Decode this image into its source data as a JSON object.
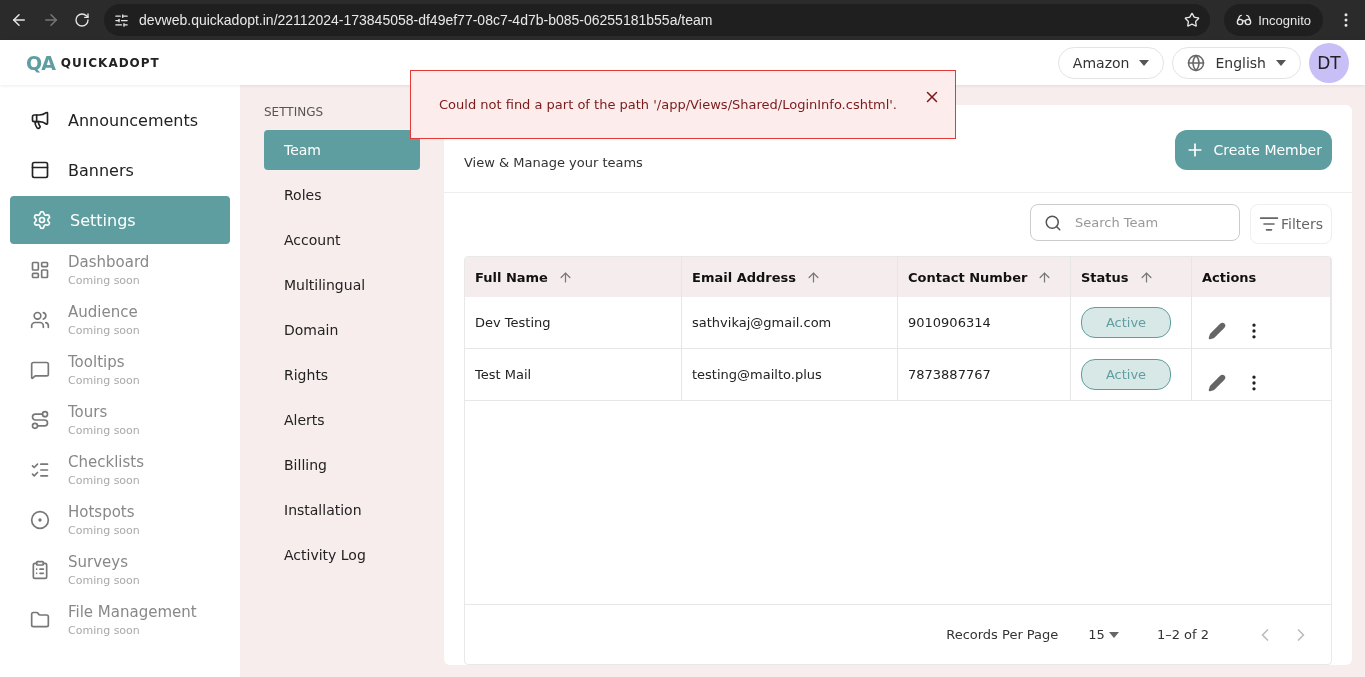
{
  "browser": {
    "url": "devweb.quickadopt.in/22112024-173845058-df49ef77-08c7-4d7b-b085-06255181b55a/team",
    "profile": "Incognito"
  },
  "header": {
    "logo_mark": "QA",
    "logo_text": "QUICKADOPT",
    "account": "Amazon",
    "language": "English",
    "avatar": "DT"
  },
  "sidebar": {
    "items": [
      {
        "label": "Announcements",
        "selected": false,
        "disabled": false
      },
      {
        "label": "Banners",
        "selected": false,
        "disabled": false
      },
      {
        "label": "Settings",
        "selected": true,
        "disabled": false
      },
      {
        "label": "Dashboard",
        "note": "Coming soon",
        "selected": false,
        "disabled": true
      },
      {
        "label": "Audience",
        "note": "Coming soon",
        "selected": false,
        "disabled": true
      },
      {
        "label": "Tooltips",
        "note": "Coming soon",
        "selected": false,
        "disabled": true
      },
      {
        "label": "Tours",
        "note": "Coming soon",
        "selected": false,
        "disabled": true
      },
      {
        "label": "Checklists",
        "note": "Coming soon",
        "selected": false,
        "disabled": true
      },
      {
        "label": "Hotspots",
        "note": "Coming soon",
        "selected": false,
        "disabled": true
      },
      {
        "label": "Surveys",
        "note": "Coming soon",
        "selected": false,
        "disabled": true
      },
      {
        "label": "File Management",
        "note": "Coming soon",
        "selected": false,
        "disabled": true
      }
    ]
  },
  "settings_menu": {
    "heading": "SETTINGS",
    "items": [
      {
        "label": "Team",
        "selected": true
      },
      {
        "label": "Roles",
        "selected": false
      },
      {
        "label": "Account",
        "selected": false
      },
      {
        "label": "Multilingual",
        "selected": false
      },
      {
        "label": "Domain",
        "selected": false
      },
      {
        "label": "Rights",
        "selected": false
      },
      {
        "label": "Alerts",
        "selected": false
      },
      {
        "label": "Billing",
        "selected": false
      },
      {
        "label": "Installation",
        "selected": false
      },
      {
        "label": "Activity Log",
        "selected": false
      }
    ]
  },
  "page": {
    "subtitle": "View & Manage your teams",
    "create_button": "Create Member",
    "search": {
      "placeholder": "Search Team"
    },
    "filters_button": "Filters"
  },
  "table": {
    "columns": [
      {
        "label": "Full Name",
        "sortable": true
      },
      {
        "label": "Email Address",
        "sortable": true
      },
      {
        "label": "Contact Number",
        "sortable": true
      },
      {
        "label": "Status",
        "sortable": true
      },
      {
        "label": "Actions",
        "sortable": false
      }
    ],
    "rows": [
      {
        "full_name": "Dev Testing",
        "email": "sathvikaj@gmail.com",
        "contact": "9010906314",
        "status": "Active"
      },
      {
        "full_name": "Test Mail",
        "email": "testing@mailto.plus",
        "contact": "7873887767",
        "status": "Active"
      }
    ]
  },
  "pagination": {
    "label": "Records Per Page",
    "per_page": "15",
    "range": "1–2 of 2",
    "prev_disabled": true,
    "next_disabled": true
  },
  "toast": {
    "message": "Could not find a part of the path '/app/Views/Shared/LoginInfo.cshtml'."
  }
}
